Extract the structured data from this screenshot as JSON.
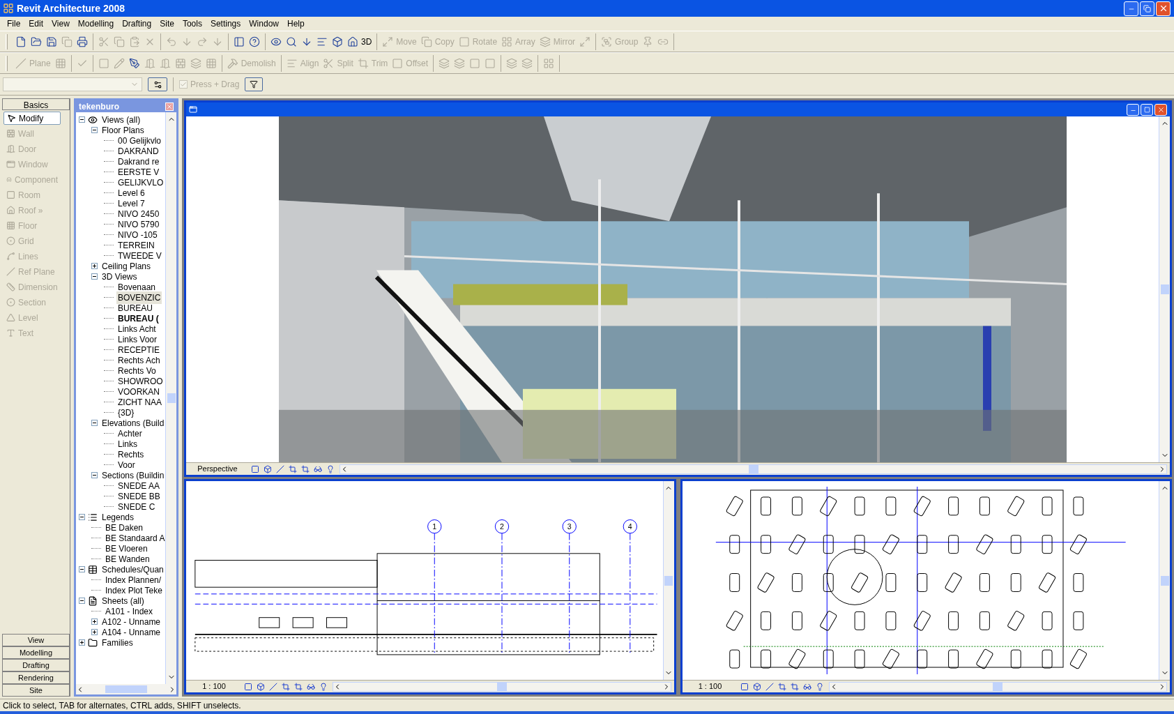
{
  "window": {
    "title": "Revit Architecture 2008"
  },
  "menu": [
    "File",
    "Edit",
    "View",
    "Modelling",
    "Drafting",
    "Site",
    "Tools",
    "Settings",
    "Window",
    "Help"
  ],
  "toolbars": [
    [
      [
        {
          "disabled": false
        },
        {
          "disabled": false
        },
        {
          "disabled": false
        },
        {
          "disabled": true
        },
        {
          "disabled": false
        }
      ],
      [
        {
          "disabled": true
        },
        {
          "disabled": true
        },
        {
          "disabled": true
        },
        {
          "disabled": true
        }
      ],
      [
        {
          "disabled": true
        },
        {
          "disabled": true
        },
        {
          "disabled": true
        },
        {
          "disabled": true
        }
      ],
      [
        {
          "disabled": false
        },
        {
          "disabled": false
        }
      ],
      [
        {
          "disabled": false
        },
        {
          "disabled": false
        },
        {
          "disabled": false
        },
        {
          "disabled": false
        },
        {
          "disabled": false
        },
        {
          "label": "3D",
          "disabled": false
        }
      ],
      [
        {
          "label": "Move",
          "disabled": true
        },
        {
          "label": "Copy",
          "disabled": true
        },
        {
          "label": "Rotate",
          "disabled": true
        },
        {
          "label": "Array",
          "disabled": true
        },
        {
          "label": "Mirror",
          "disabled": true
        },
        {
          "disabled": true
        }
      ],
      [
        {
          "label": "Group",
          "disabled": true
        },
        {
          "disabled": true
        },
        {
          "disabled": true
        }
      ]
    ],
    [
      [
        {
          "label": "Plane",
          "disabled": true
        },
        {
          "disabled": true
        }
      ],
      [
        {
          "disabled": true
        }
      ],
      [
        {
          "disabled": true
        },
        {
          "disabled": true
        },
        {
          "disabled": false
        },
        {
          "disabled": true
        },
        {
          "disabled": true
        },
        {
          "disabled": true
        },
        {
          "disabled": true
        },
        {
          "disabled": true
        }
      ],
      [
        {
          "label": "Demolish",
          "disabled": true
        }
      ],
      [
        {
          "label": "Align",
          "disabled": true
        },
        {
          "label": "Split",
          "disabled": true
        },
        {
          "label": "Trim",
          "disabled": true
        },
        {
          "label": "Offset",
          "disabled": true
        }
      ],
      [
        {
          "disabled": true
        },
        {
          "disabled": true
        },
        {
          "disabled": true
        },
        {
          "disabled": true
        }
      ],
      [
        {
          "disabled": true
        },
        {
          "disabled": true
        }
      ],
      [
        {
          "disabled": true
        }
      ]
    ]
  ],
  "options_bar": {
    "type_selector": {
      "disabled": true
    },
    "press_drag": {
      "label": "Press + Drag",
      "checked": true,
      "disabled": true
    }
  },
  "design_bar": {
    "tab": "Basics",
    "tools": [
      {
        "label": "Modify",
        "selected": true,
        "disabled": false
      },
      {
        "label": "Wall",
        "selected": false,
        "disabled": true
      },
      {
        "label": "Door",
        "selected": false,
        "disabled": true
      },
      {
        "label": "Window",
        "selected": false,
        "disabled": true
      },
      {
        "label": "Component",
        "selected": false,
        "disabled": true
      },
      {
        "label": "Room",
        "selected": false,
        "disabled": true
      },
      {
        "label": "Roof »",
        "selected": false,
        "disabled": true
      },
      {
        "label": "Floor",
        "selected": false,
        "disabled": true
      },
      {
        "label": "Grid",
        "selected": false,
        "disabled": true
      },
      {
        "label": "Lines",
        "selected": false,
        "disabled": true
      },
      {
        "label": "Ref Plane",
        "selected": false,
        "disabled": true
      },
      {
        "label": "Dimension",
        "selected": false,
        "disabled": true
      },
      {
        "label": "Section",
        "selected": false,
        "disabled": true
      },
      {
        "label": "Level",
        "selected": false,
        "disabled": true
      },
      {
        "label": "Text",
        "selected": false,
        "disabled": true
      }
    ],
    "tabs": [
      "View",
      "Modelling",
      "Drafting",
      "Rendering",
      "Site"
    ]
  },
  "project_browser": {
    "title": "tekenburo",
    "tree": [
      {
        "label": "Views (all)",
        "expanded": true,
        "children": [
          {
            "label": "Floor Plans",
            "expanded": true,
            "children": [
              {
                "label": "00 Gelijkvlo",
                "selected": false,
                "current": false
              },
              {
                "label": "DAKRAND",
                "selected": false,
                "current": false
              },
              {
                "label": "Dakrand re",
                "selected": false,
                "current": false
              },
              {
                "label": "EERSTE V",
                "selected": false,
                "current": false
              },
              {
                "label": "GELIJKVLO",
                "selected": false,
                "current": false
              },
              {
                "label": "Level 6",
                "selected": false,
                "current": false
              },
              {
                "label": "Level 7",
                "selected": false,
                "current": false
              },
              {
                "label": "NIVO 2450",
                "selected": false,
                "current": false
              },
              {
                "label": "NIVO 5790",
                "selected": false,
                "current": false
              },
              {
                "label": "NIVO -105",
                "selected": false,
                "current": false
              },
              {
                "label": "TERREIN",
                "selected": false,
                "current": false
              },
              {
                "label": "TWEEDE V",
                "selected": false,
                "current": false
              }
            ]
          },
          {
            "label": "Ceiling Plans",
            "expanded": false
          },
          {
            "label": "3D Views",
            "expanded": true,
            "children": [
              {
                "label": "Bovenaan",
                "selected": false,
                "current": false
              },
              {
                "label": "BOVENZIC",
                "selected": true,
                "current": false
              },
              {
                "label": "BUREAU",
                "selected": false,
                "current": false
              },
              {
                "label": "BUREAU (",
                "selected": false,
                "current": true
              },
              {
                "label": "Links Acht",
                "selected": false,
                "current": false
              },
              {
                "label": "Links Voor",
                "selected": false,
                "current": false
              },
              {
                "label": "RECEPTIE",
                "selected": false,
                "current": false
              },
              {
                "label": "Rechts Ach",
                "selected": false,
                "current": false
              },
              {
                "label": "Rechts Vo",
                "selected": false,
                "current": false
              },
              {
                "label": "SHOWROO",
                "selected": false,
                "current": false
              },
              {
                "label": "VOORKAN",
                "selected": false,
                "current": false
              },
              {
                "label": "ZICHT NAA",
                "selected": false,
                "current": false
              },
              {
                "label": "{3D}",
                "selected": false,
                "current": false
              }
            ]
          },
          {
            "label": "Elevations (Build",
            "expanded": true,
            "children": [
              {
                "label": "Achter",
                "selected": false,
                "current": false
              },
              {
                "label": "Links",
                "selected": false,
                "current": false
              },
              {
                "label": "Rechts",
                "selected": false,
                "current": false
              },
              {
                "label": "Voor",
                "selected": false,
                "current": false
              }
            ]
          },
          {
            "label": "Sections (Buildin",
            "expanded": true,
            "children": [
              {
                "label": "SNEDE AA",
                "selected": false,
                "current": false
              },
              {
                "label": "SNEDE BB",
                "selected": false,
                "current": false
              },
              {
                "label": "SNEDE C",
                "selected": false,
                "current": false
              }
            ]
          }
        ]
      },
      {
        "label": "Legends",
        "expanded": true,
        "children": [
          {
            "label": "BE Daken",
            "selected": false,
            "current": false
          },
          {
            "label": "BE Standaard A",
            "selected": false,
            "current": false
          },
          {
            "label": "BE Vloeren",
            "selected": false,
            "current": false
          },
          {
            "label": "BE Wanden",
            "selected": false,
            "current": false
          }
        ]
      },
      {
        "label": "Schedules/Quan",
        "expanded": true,
        "children": [
          {
            "label": "Index Plannen/",
            "selected": false,
            "current": false
          },
          {
            "label": "Index Plot Teke",
            "selected": false,
            "current": false
          }
        ]
      },
      {
        "label": "Sheets (all)",
        "expanded": true,
        "children": [
          {
            "label": "A101 - Index",
            "selected": false,
            "current": false
          },
          {
            "label": "A102 - Unname",
            "expanded": false
          },
          {
            "label": "A104 - Unname",
            "expanded": false
          }
        ]
      },
      {
        "label": "Families",
        "expanded": false
      }
    ]
  },
  "views": {
    "perspective": {
      "scale": "Perspective"
    },
    "section": {
      "scale": "1 : 100",
      "grid_labels": [
        "1",
        "2",
        "3",
        "4"
      ]
    },
    "plan": {
      "scale": "1 : 100"
    }
  },
  "status_bar": "Click to select, TAB for alternates, CTRL adds, SHIFT unselects."
}
